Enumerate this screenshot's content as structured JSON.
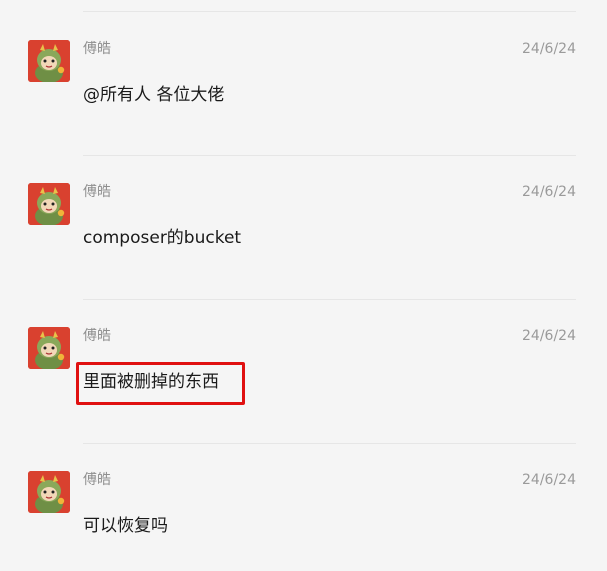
{
  "messages": [
    {
      "sender": "傅皓",
      "time": "24/6/24",
      "content": "@所有人 各位大佬"
    },
    {
      "sender": "傅皓",
      "time": "24/6/24",
      "content": "composer的bucket"
    },
    {
      "sender": "傅皓",
      "time": "24/6/24",
      "content": "里面被删掉的东西"
    },
    {
      "sender": "傅皓",
      "time": "24/6/24",
      "content": "可以恢复吗"
    }
  ],
  "avatar_icon": "dragon-cartoon-avatar-icon",
  "colors": {
    "background": "#f5f5f5",
    "highlight_border": "#e01010",
    "avatar_bg": "#d9412f"
  }
}
